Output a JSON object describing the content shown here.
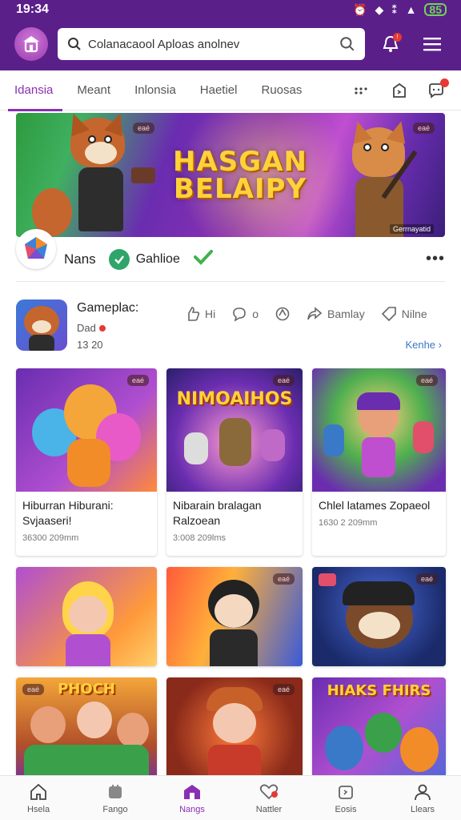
{
  "status": {
    "time": "19:34",
    "battery": "85"
  },
  "search": {
    "value": "Colanacaool Aploas anolnev"
  },
  "tabs": [
    "Idansia",
    "Meant",
    "Inlonsia",
    "Haetiel",
    "Ruosas"
  ],
  "banner": {
    "title_line1": "HASGAN",
    "title_line2": "BELAIPY",
    "caption": "Gerrnayatid",
    "chip_left": "eaé",
    "chip_right": "eaé"
  },
  "channel": {
    "name": "Nans",
    "game": "Gahlioe"
  },
  "game": {
    "title": "Gameplac:",
    "subtitle": "Dad",
    "date": "13 20",
    "actions": [
      "Hi",
      "o",
      "",
      "Bamlay",
      "Nilne"
    ],
    "more_link": "Kenhe"
  },
  "cards": [
    {
      "title": "Hiburran Hiburani: Svjaaseri!",
      "meta": "36300 209mm",
      "badge": "eaé"
    },
    {
      "title": "Nibarain bralagan Ralzoean",
      "meta": "3:008 209lms",
      "badge": "eaé",
      "thumb_text": "NIMOAIHOS"
    },
    {
      "title": "Chlel latames Zopaeol",
      "meta": "1630 2 209mm",
      "badge": "eaé"
    },
    {
      "badge": ""
    },
    {
      "badge": "eaé"
    },
    {
      "badge": "eaé"
    },
    {
      "badge": "eaé",
      "thumb_text": "PHOCH"
    },
    {
      "badge": "eaé"
    },
    {
      "badge": "",
      "thumb_text": "HIAKS FHIRS"
    }
  ],
  "bottom_nav": [
    "Hsela",
    "Fango",
    "Nangs",
    "Nattler",
    "Eosis",
    "Llears"
  ],
  "colors": {
    "brand": "#5b1f8a",
    "accent": "#8a2fb3",
    "link": "#3a79c8"
  }
}
